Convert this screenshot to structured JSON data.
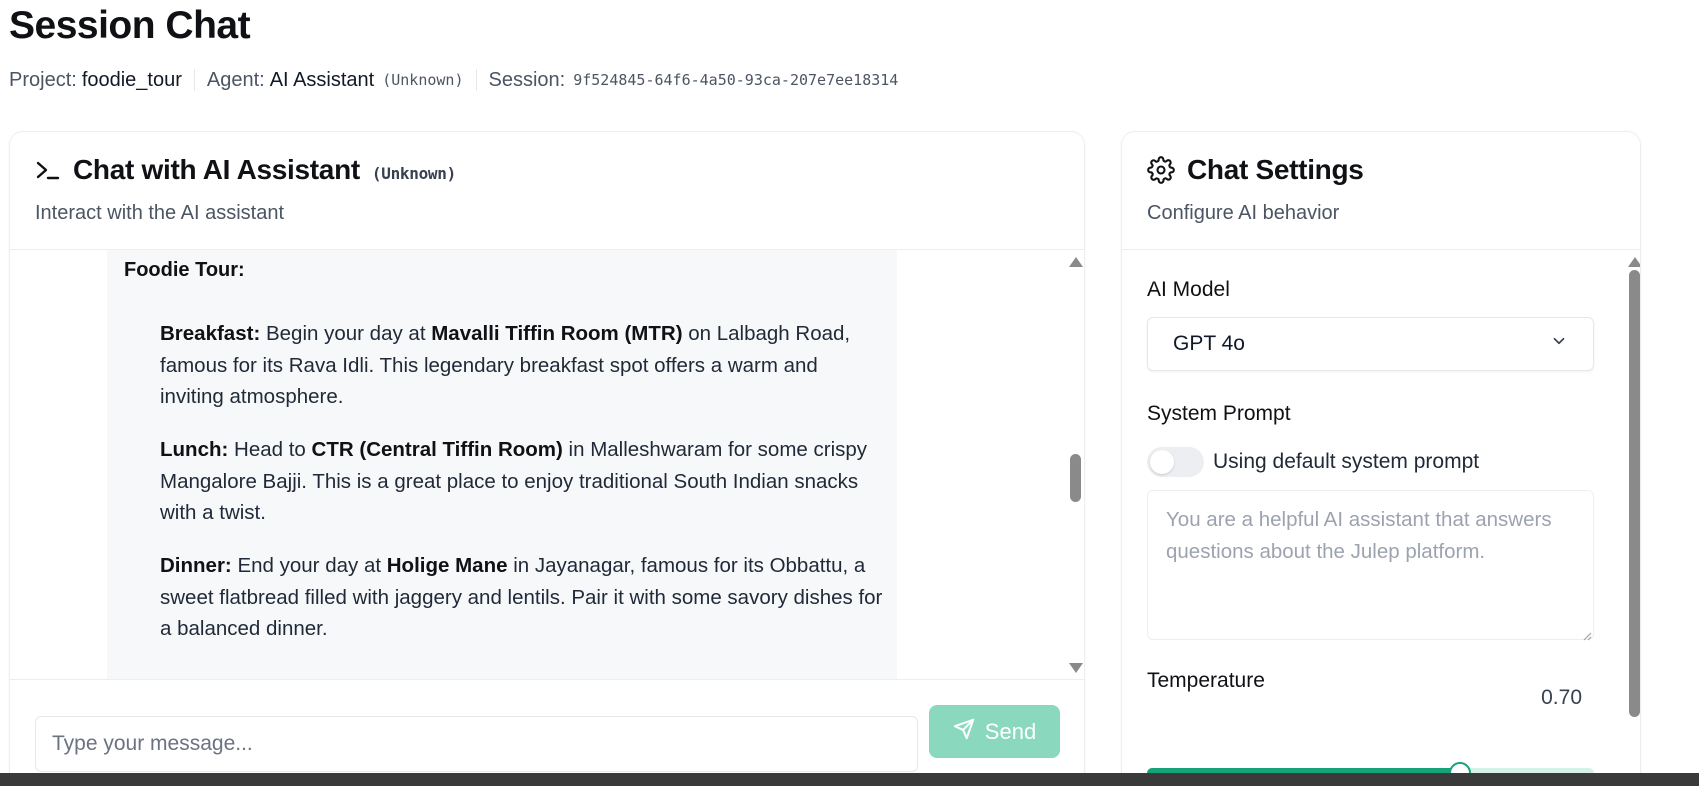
{
  "page": {
    "title": "Session Chat",
    "project_label": "Project:",
    "project_value": "foodie_tour",
    "agent_label": "Agent:",
    "agent_value": "AI Assistant",
    "agent_status": "(Unknown)",
    "session_label": "Session:",
    "session_value": "9f524845-64f6-4a50-93ca-207e7ee18314"
  },
  "chat": {
    "title": "Chat with AI Assistant",
    "title_status": "(Unknown)",
    "subtitle": "Interact with the AI assistant",
    "message": {
      "heading": "Foodie Tour:",
      "sections": [
        {
          "label": "Breakfast:",
          "pre": "Begin your day at",
          "place": "Mavalli Tiffin Room (MTR)",
          "post": "on Lalbagh Road, famous for its Rava Idli. This legendary breakfast spot offers a warm and inviting atmosphere."
        },
        {
          "label": "Lunch:",
          "pre": "Head to",
          "place": "CTR (Central Tiffin Room)",
          "post": "in Malleshwaram for some crispy Mangalore Bajji. This is a great place to enjoy traditional South Indian snacks with a twist."
        },
        {
          "label": "Dinner:",
          "pre": "End your day at",
          "place": "Holige Mane",
          "post": "in Jayanagar, famous for its Obbattu, a sweet flatbread filled with jaggery and lentils. Pair it with some savory dishes for a balanced dinner."
        }
      ]
    },
    "input_placeholder": "Type your message...",
    "send_label": "Send",
    "send_color": "#8ad9bf"
  },
  "settings": {
    "title": "Chat Settings",
    "subtitle": "Configure AI behavior",
    "model_label": "AI Model",
    "model_value": "GPT 4o",
    "system_prompt_label": "System Prompt",
    "toggle_on": false,
    "toggle_label": "Using default system prompt",
    "system_prompt_placeholder": "You are a helpful AI assistant that answers questions about the Julep platform.",
    "temperature_label": "Temperature",
    "temperature_value": "0.70",
    "temperature_fraction": 0.7,
    "accent_color": "#16a37a"
  }
}
